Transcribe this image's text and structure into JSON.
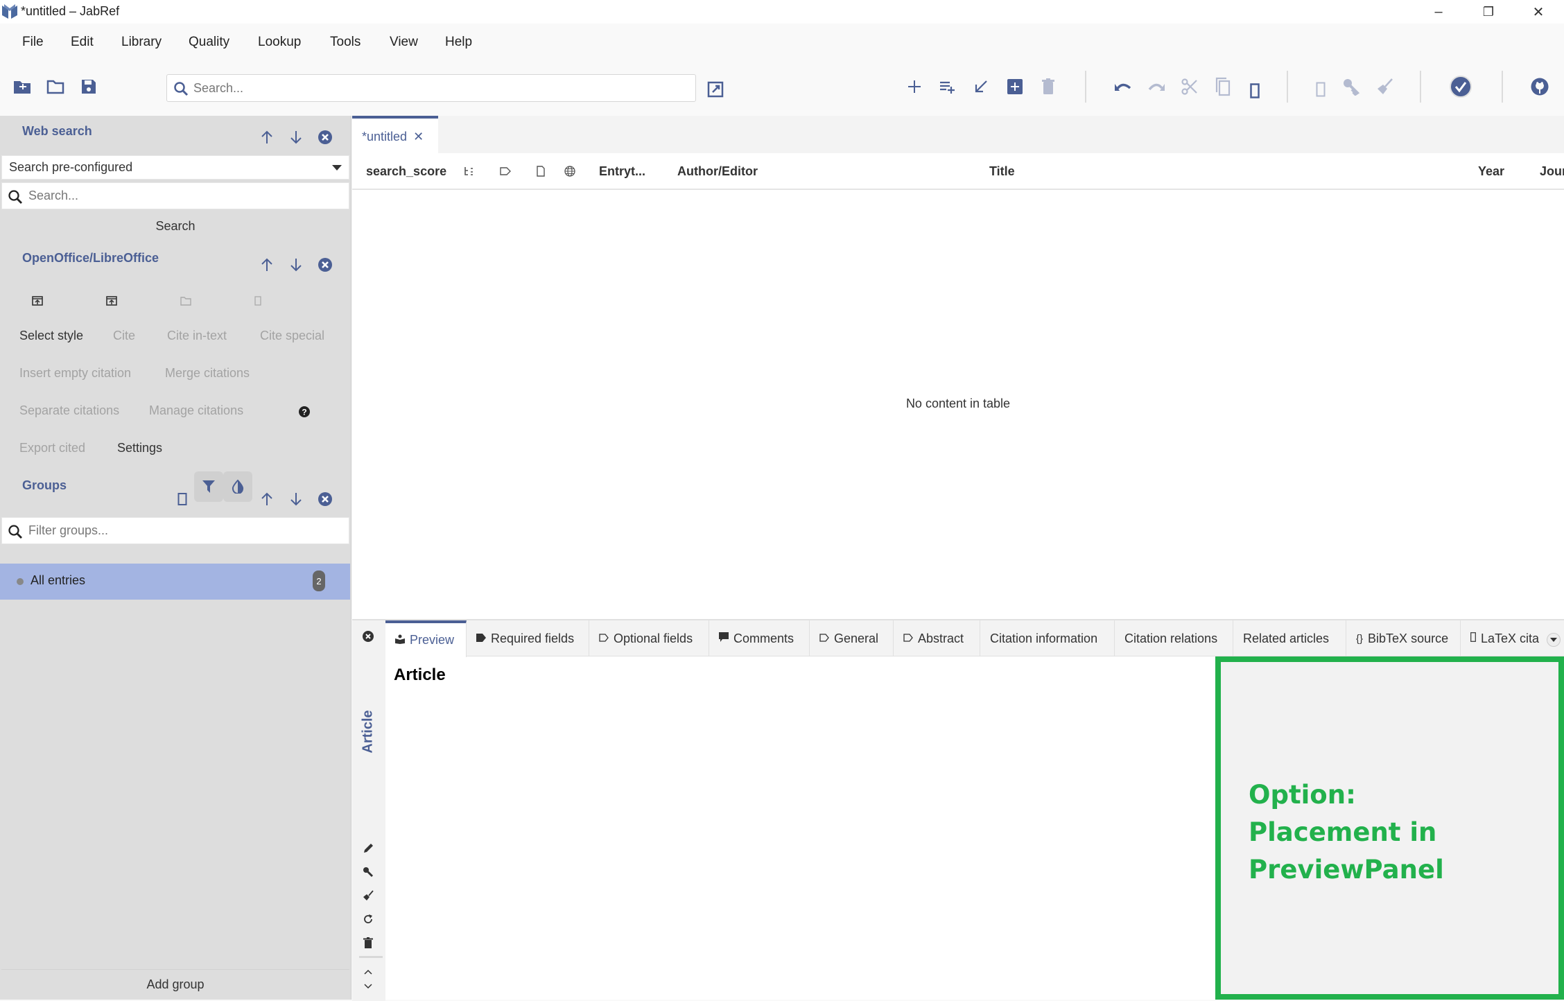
{
  "window": {
    "title": "*untitled – JabRef",
    "controls": {
      "minimize": "–",
      "restore": "❐",
      "close": "✕"
    }
  },
  "menu": [
    "File",
    "Edit",
    "Library",
    "Quality",
    "Lookup",
    "Tools",
    "View",
    "Help"
  ],
  "toolbar": {
    "search_placeholder": "Search...",
    "icons": [
      "new-library-icon",
      "open-library-icon",
      "save-icon",
      "global-search-popout-icon",
      "add-entry-icon",
      "add-entry-from-id-icon",
      "import-icon",
      "new-entry-plus-icon",
      "delete-icon",
      "undo-icon",
      "redo-icon",
      "cut-icon",
      "copy-icon",
      "paste-icon",
      "generate-key-icon",
      "key-icon",
      "cleanup-icon",
      "check-integrity-icon",
      "github-icon"
    ]
  },
  "sidebar": {
    "web_search": {
      "title": "Web search",
      "fetcher_selected": "Search pre-configured",
      "search_placeholder": "Search...",
      "search_button": "Search"
    },
    "openoffice": {
      "title": "OpenOffice/LibreOffice",
      "buttons": [
        {
          "label": "Select style",
          "enabled": true
        },
        {
          "label": "Cite",
          "enabled": false
        },
        {
          "label": "Cite in-text",
          "enabled": false
        },
        {
          "label": "Cite special",
          "enabled": false
        },
        {
          "label": "Insert empty citation",
          "enabled": false
        },
        {
          "label": "Merge citations",
          "enabled": false
        },
        {
          "label": "Separate citations",
          "enabled": false
        },
        {
          "label": "Manage citations",
          "enabled": false
        },
        {
          "label": "Export cited",
          "enabled": false
        },
        {
          "label": "Settings",
          "enabled": true
        }
      ]
    },
    "groups": {
      "title": "Groups",
      "filter_placeholder": "Filter groups...",
      "items": [
        {
          "label": "All entries",
          "count": "2"
        }
      ],
      "add_group": "Add group"
    }
  },
  "library_tab": {
    "label": "*untitled",
    "close": "✕"
  },
  "table": {
    "columns": [
      "search_score",
      "Entryt...",
      "Author/Editor",
      "Title",
      "Year",
      "Jour"
    ],
    "empty_message": "No content in table"
  },
  "entry_editor": {
    "entry_type": "Article",
    "tabs": [
      {
        "label": "Preview",
        "icon": "preview-icon",
        "active": true
      },
      {
        "label": "Required fields",
        "icon": "required-fields-icon"
      },
      {
        "label": "Optional fields",
        "icon": "optional-fields-icon"
      },
      {
        "label": "Comments",
        "icon": "comments-icon"
      },
      {
        "label": "General",
        "icon": "general-icon"
      },
      {
        "label": "Abstract",
        "icon": "abstract-icon"
      },
      {
        "label": "Citation information"
      },
      {
        "label": "Citation relations"
      },
      {
        "label": "Related articles"
      },
      {
        "label": "BibTeX source",
        "icon": "bibtex-icon"
      },
      {
        "label": "LaTeX cita",
        "icon": "latex-icon"
      }
    ],
    "preview_heading": "Article"
  },
  "annotation": {
    "lines": [
      "Option:",
      "Placement in",
      "PreviewPanel"
    ],
    "color": "#22b14c"
  },
  "colors": {
    "accent": "#4b5f94",
    "sidebar_bg": "#dddddd",
    "selected_group": "#a3b4e2"
  }
}
